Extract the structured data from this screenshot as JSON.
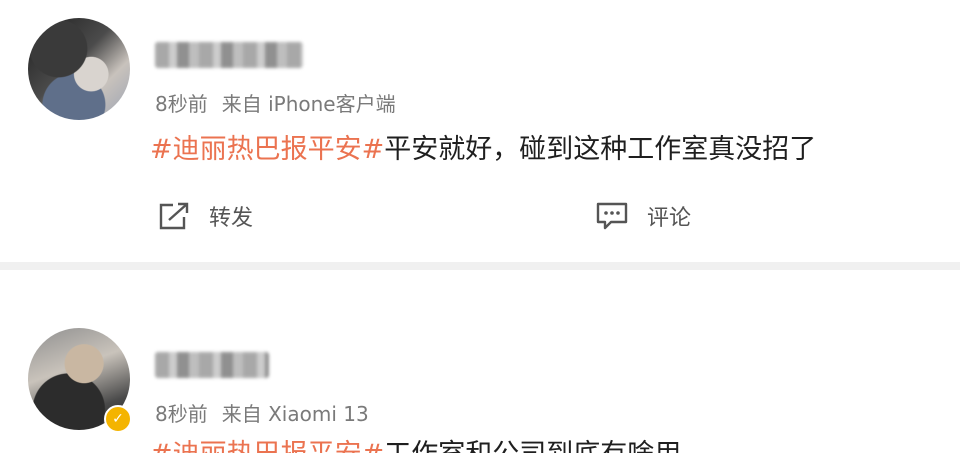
{
  "posts": [
    {
      "meta": {
        "time": "8秒前",
        "source": "来自 iPhone客户端"
      },
      "content": {
        "hashtag": "#迪丽热巴报平安#",
        "text": "平安就好，碰到这种工作室真没招了"
      },
      "actions": {
        "repost_label": "转发",
        "comment_label": "评论"
      }
    },
    {
      "meta": {
        "time": "8秒前",
        "source": "来自 Xiaomi 13"
      },
      "badge": "✓",
      "content": {
        "hashtag": "#迪丽热巴报平安#",
        "text": "工作室和公司到底有啥用"
      }
    }
  ],
  "colors": {
    "hashtag": "#eb7350",
    "meta": "#7a7a7a",
    "verified_badge": "#f4b400"
  },
  "icons": {
    "repost": "repost-icon",
    "comment": "comment-icon"
  }
}
